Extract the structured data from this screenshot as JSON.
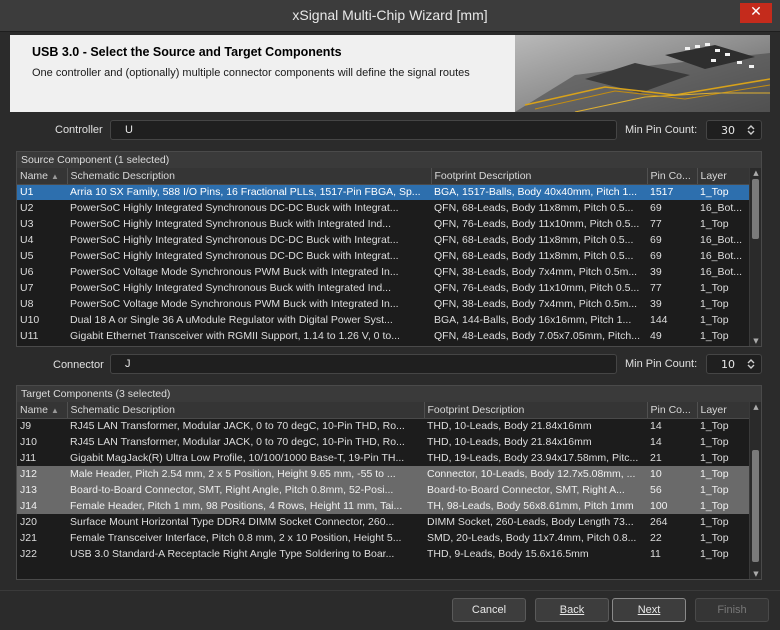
{
  "window": {
    "title": "xSignal Multi-Chip Wizard [mm]",
    "close_glyph": "✕"
  },
  "header": {
    "title": "USB 3.0 - Select the Source and Target Components",
    "subtitle": "One controller and (optionally) multiple connector components will define the signal routes"
  },
  "controller": {
    "label": "Controller",
    "value": "U",
    "min_pin_label": "Min Pin Count:",
    "min_pin_value": "30"
  },
  "connector": {
    "label": "Connector",
    "value": "J",
    "min_pin_label": "Min Pin Count:",
    "min_pin_value": "10"
  },
  "source": {
    "caption": "Source Component (1 selected)",
    "columns": [
      "Name",
      "Schematic Description",
      "Footprint Description",
      "Pin Co...",
      "Layer"
    ],
    "rows": [
      [
        "U1",
        "Arria 10 SX Family, 588 I/O Pins, 16 Fractional PLLs, 1517-Pin FBGA, Sp...",
        "BGA, 1517-Balls, Body 40x40mm, Pitch 1...",
        "1517",
        "1_Top"
      ],
      [
        "U2",
        "PowerSoC Highly Integrated Synchronous DC-DC Buck with Integrat...",
        "QFN, 68-Leads, Body 11x8mm, Pitch 0.5...",
        "69",
        "16_Bot..."
      ],
      [
        "U3",
        "PowerSoC Highly Integrated Synchronous Buck with Integrated Ind...",
        "QFN, 76-Leads, Body 11x10mm, Pitch 0.5...",
        "77",
        "1_Top"
      ],
      [
        "U4",
        "PowerSoC Highly Integrated Synchronous DC-DC Buck with Integrat...",
        "QFN, 68-Leads, Body 11x8mm, Pitch 0.5...",
        "69",
        "16_Bot..."
      ],
      [
        "U5",
        "PowerSoC Highly Integrated Synchronous DC-DC Buck with Integrat...",
        "QFN, 68-Leads, Body 11x8mm, Pitch 0.5...",
        "69",
        "16_Bot..."
      ],
      [
        "U6",
        "PowerSoC Voltage Mode Synchronous PWM Buck with Integrated In...",
        "QFN, 38-Leads, Body 7x4mm, Pitch 0.5m...",
        "39",
        "16_Bot..."
      ],
      [
        "U7",
        "PowerSoC Highly Integrated Synchronous Buck with Integrated Ind...",
        "QFN, 76-Leads, Body 11x10mm, Pitch 0.5...",
        "77",
        "1_Top"
      ],
      [
        "U8",
        "PowerSoC Voltage Mode Synchronous PWM Buck with Integrated In...",
        "QFN, 38-Leads, Body 7x4mm, Pitch 0.5m...",
        "39",
        "1_Top"
      ],
      [
        "U10",
        "Dual 18 A or Single 36 A uModule Regulator with Digital Power Syst...",
        "BGA, 144-Balls, Body 16x16mm, Pitch 1...",
        "144",
        "1_Top"
      ],
      [
        "U11",
        "Gigabit Ethernet Transceiver with RGMII Support, 1.14 to 1.26 V, 0 to...",
        "QFN, 48-Leads, Body 7.05x7.05mm, Pitch...",
        "49",
        "1_Top"
      ]
    ]
  },
  "target": {
    "caption": "Target Components (3 selected)",
    "columns": [
      "Name",
      "Schematic Description",
      "Footprint Description",
      "Pin Co...",
      "Layer"
    ],
    "rows": [
      [
        "J9",
        "RJ45 LAN Transformer, Modular JACK, 0 to 70 degC, 10-Pin THD, Ro...",
        "THD, 10-Leads, Body 21.84x16mm",
        "14",
        "1_Top"
      ],
      [
        "J10",
        "RJ45 LAN Transformer, Modular JACK, 0 to 70 degC, 10-Pin THD, Ro...",
        "THD, 10-Leads, Body 21.84x16mm",
        "14",
        "1_Top"
      ],
      [
        "J11",
        "Gigabit MagJack(R) Ultra Low Profile, 10/100/1000 Base-T, 19-Pin TH...",
        "THD, 19-Leads, Body 23.94x17.58mm, Pitc...",
        "21",
        "1_Top"
      ],
      [
        "J12",
        "Male Header, Pitch 2.54 mm, 2 x 5 Position, Height 9.65 mm, -55 to ...",
        "Connector, 10-Leads, Body 12.7x5.08mm, ...",
        "10",
        "1_Top"
      ],
      [
        "J13",
        "Board-to-Board Connector, SMT, Right Angle, Pitch 0.8mm, 52-Posi...",
        "Board-to-Board Connector, SMT, Right A...",
        "56",
        "1_Top"
      ],
      [
        "J14",
        "Female Header, Pitch 1 mm, 98 Positions, 4 Rows, Height 11 mm, Tai...",
        "TH, 98-Leads, Body 56x8.61mm, Pitch 1mm",
        "100",
        "1_Top"
      ],
      [
        "J20",
        "Surface Mount Horizontal Type DDR4 DIMM Socket Connector, 260...",
        "DIMM Socket, 260-Leads, Body Length 73...",
        "264",
        "1_Top"
      ],
      [
        "J21",
        "Female Transceiver Interface, Pitch 0.8 mm, 2 x 10 Position, Height 5...",
        "SMD, 20-Leads, Body 11x7.4mm, Pitch 0.8...",
        "22",
        "1_Top"
      ],
      [
        "J22",
        "USB 3.0 Standard-A Receptacle Right Angle Type Soldering to Boar...",
        "THD, 9-Leads, Body 15.6x16.5mm",
        "11",
        "1_Top"
      ]
    ]
  },
  "buttons": {
    "cancel": "Cancel",
    "back": "Back",
    "next": "Next",
    "finish": "Finish"
  }
}
